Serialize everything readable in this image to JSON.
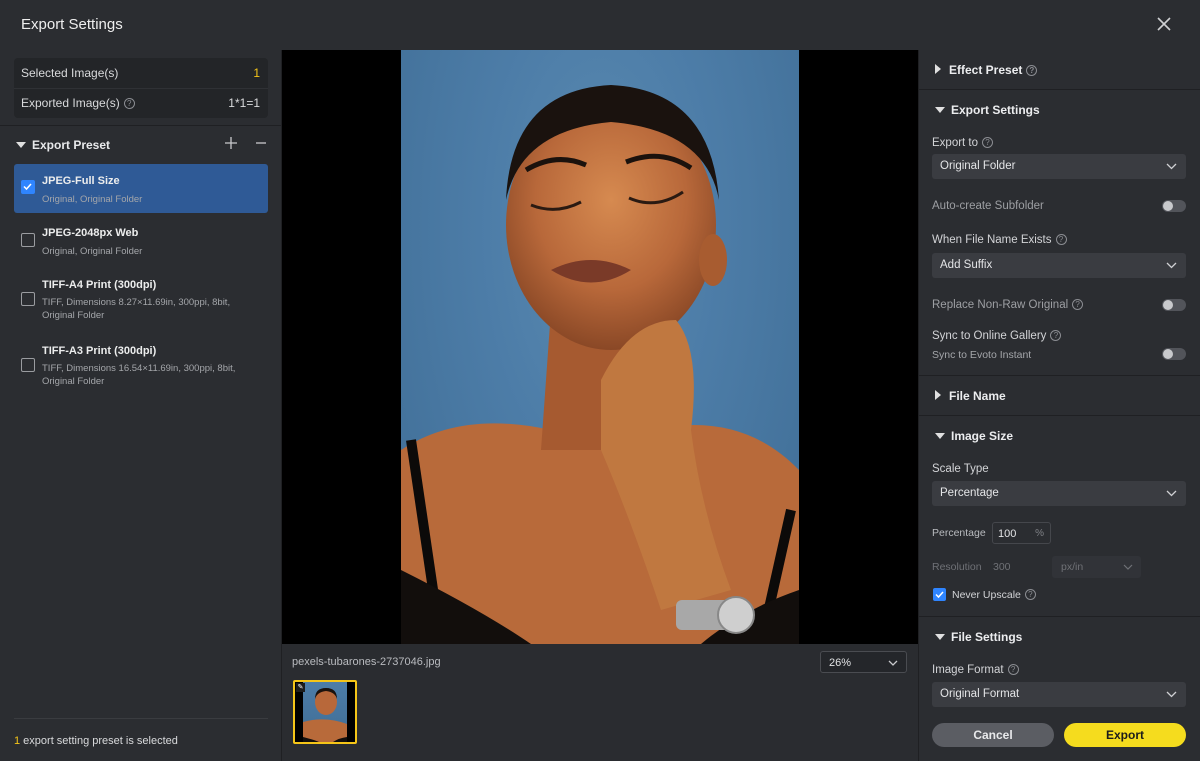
{
  "window": {
    "title": "Export Settings"
  },
  "stats": {
    "selected_label": "Selected Image(s)",
    "selected_value": "1",
    "exported_label": "Exported Image(s)",
    "exported_value": "1*1=1"
  },
  "presets": {
    "header": "Export Preset",
    "items": [
      {
        "name": "JPEG-Full Size",
        "desc": "Original, Original Folder",
        "checked": true
      },
      {
        "name": "JPEG-2048px Web",
        "desc": "Original, Original Folder",
        "checked": false
      },
      {
        "name": "TIFF-A4 Print (300dpi)",
        "desc": "TIFF, Dimensions 8.27×11.69in, 300ppi, 8bit, Original Folder",
        "checked": false
      },
      {
        "name": "TIFF-A3 Print (300dpi)",
        "desc": "TIFF, Dimensions 16.54×11.69in, 300ppi, 8bit, Original Folder",
        "checked": false
      }
    ],
    "status_count": "1",
    "status_text": " export setting preset is selected"
  },
  "preview": {
    "filename": "pexels-tubarones-2737046.jpg",
    "zoom": "26%"
  },
  "right": {
    "effect_preset": "Effect Preset",
    "export_settings": "Export Settings",
    "export_to_label": "Export to",
    "export_to_value": "Original Folder",
    "auto_subfolder": "Auto-create Subfolder",
    "when_exists_label": "When File Name Exists",
    "when_exists_value": "Add Suffix",
    "replace_nonraw": "Replace Non-Raw Original",
    "sync_gallery": "Sync to Online Gallery",
    "sync_sub": "Sync to Evoto Instant",
    "file_name": "File Name",
    "image_size": "Image Size",
    "scale_type_label": "Scale Type",
    "scale_type_value": "Percentage",
    "percentage_label": "Percentage",
    "percentage_value": "100",
    "percentage_unit": "%",
    "resolution_label": "Resolution",
    "resolution_value": "300",
    "resolution_unit": "px/in",
    "never_upscale": "Never Upscale",
    "file_settings": "File Settings",
    "image_format_label": "Image Format",
    "image_format_value": "Original Format",
    "cancel": "Cancel",
    "export": "Export"
  },
  "colors": {
    "accent_yellow": "#f5dc1e",
    "check_blue": "#2f85ff",
    "selected_row": "#2f5a96"
  }
}
